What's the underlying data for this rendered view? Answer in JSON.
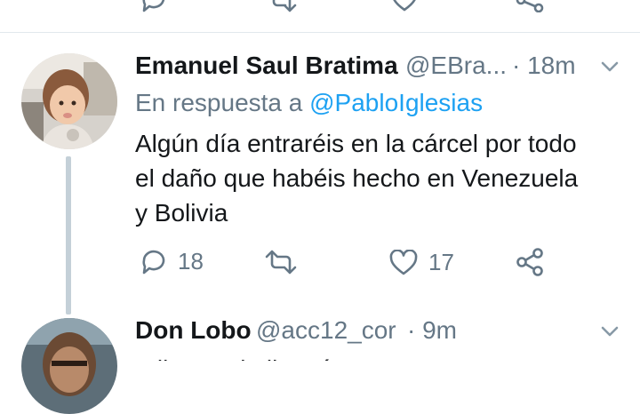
{
  "tweets": [
    {
      "author_name": "Emanuel Saul Bratima",
      "handle": "@EBra...",
      "time": "· 18m",
      "reply_prefix": "En respuesta a ",
      "reply_mention": "@PabloIglesias",
      "text_lines": [
        "Algún día entraréis en la cárcel por todo",
        "el daño que habéis hecho en Venezuela",
        "y Bolivia"
      ],
      "reply_count": "18",
      "like_count": "17"
    },
    {
      "author_name": "Don Lobo",
      "handle": "@acc12_cor",
      "time": "· 9m",
      "text_partial": "A llorar a la llorería"
    }
  ],
  "icons": {
    "reply": "reply-icon",
    "retweet": "retweet-icon",
    "like": "heart-icon",
    "share": "share-icon",
    "menu": "chevron-down-icon"
  },
  "colors": {
    "link": "#1da1f2",
    "secondary_text": "#657786",
    "thread_line": "#c4d0d8"
  }
}
